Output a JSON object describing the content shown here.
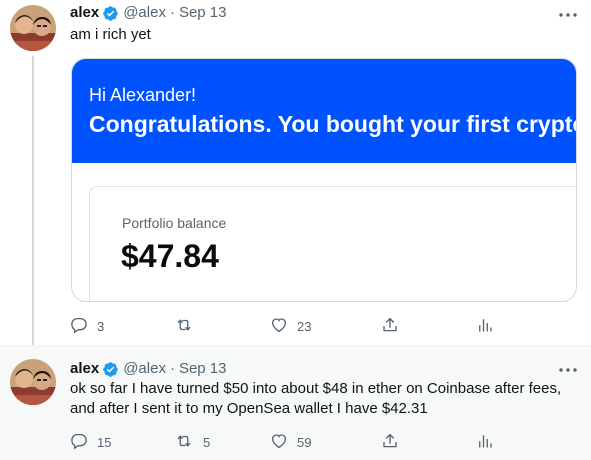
{
  "colors": {
    "verified": "#1d9bf0",
    "card_banner": "#0052ff",
    "secondary_text": "#536471"
  },
  "tweets": [
    {
      "author": {
        "name": "alex",
        "handle": "@alex",
        "verified_icon": "verified-badge-icon",
        "avatar": "profile-photo"
      },
      "separator": "·",
      "date": "Sep 13",
      "text": "am i rich yet",
      "card": {
        "greeting": "Hi Alexander!",
        "headline": "Congratulations. You bought your first crypto!",
        "balance_label": "Portfolio balance",
        "balance_value": "$47.84"
      },
      "actions": {
        "replies": "3",
        "retweets": "",
        "likes": "23"
      }
    },
    {
      "author": {
        "name": "alex",
        "handle": "@alex",
        "verified_icon": "verified-badge-icon",
        "avatar": "profile-photo"
      },
      "separator": "·",
      "date": "Sep 13",
      "text": "ok so far I have turned $50 into about $48 in ether on Coinbase after fees, and after I sent it to my OpenSea wallet I have $42.31",
      "actions": {
        "replies": "15",
        "retweets": "5",
        "likes": "59"
      }
    }
  ]
}
